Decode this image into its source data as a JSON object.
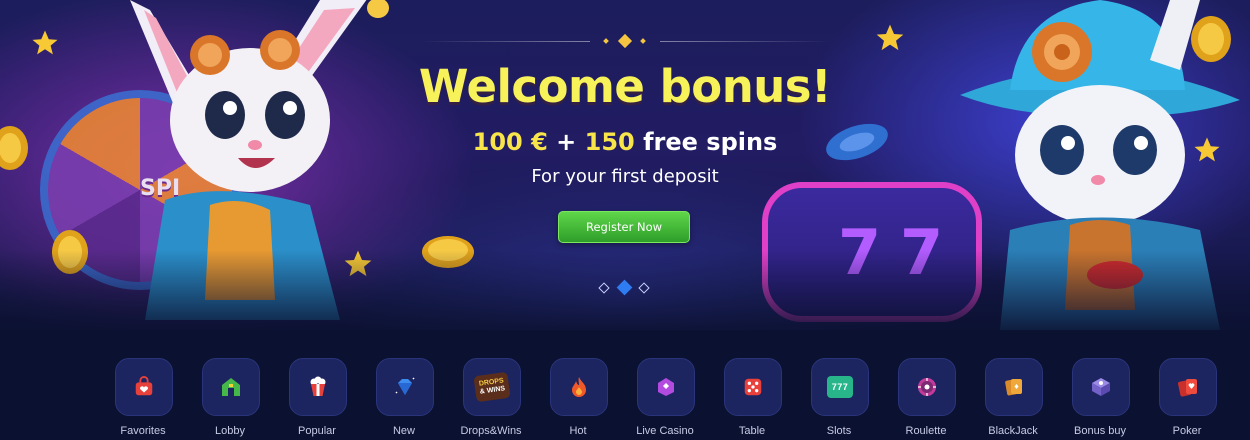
{
  "banner": {
    "title": "Welcome bonus!",
    "offer": {
      "amount": "100 €",
      "plus": "+",
      "spins_count": "150",
      "spins_text": "free spins"
    },
    "subtitle": "For your first deposit",
    "register_label": "Register Now",
    "slides": {
      "count": 3,
      "active": 2
    },
    "wheel_text": "SPI",
    "slot_digit": "7"
  },
  "categories": [
    {
      "label": "Favorites",
      "icon": "heart-bag-icon"
    },
    {
      "label": "Lobby",
      "icon": "house-icon"
    },
    {
      "label": "Popular",
      "icon": "popcorn-icon"
    },
    {
      "label": "New",
      "icon": "diamond-icon"
    },
    {
      "label": "Drops&Wins",
      "icon": "drops-wins-icon",
      "badge_line1": "DROPS",
      "badge_line2": "& WINS"
    },
    {
      "label": "Hot",
      "icon": "fire-icon"
    },
    {
      "label": "Live Casino",
      "icon": "live-dealer-icon"
    },
    {
      "label": "Table",
      "icon": "dice-icon"
    },
    {
      "label": "Slots",
      "icon": "slot-machine-icon",
      "reel_text": "777"
    },
    {
      "label": "Roulette",
      "icon": "roulette-icon"
    },
    {
      "label": "BlackJack",
      "icon": "cards-icon"
    },
    {
      "label": "Bonus buy",
      "icon": "bonus-box-icon"
    },
    {
      "label": "Poker",
      "icon": "poker-cards-icon"
    }
  ],
  "colors": {
    "title_yellow": "#f8f25a",
    "register_green": "#3fb830",
    "active_dot": "#2f7bf2",
    "tile_bg": "#1c2560"
  }
}
